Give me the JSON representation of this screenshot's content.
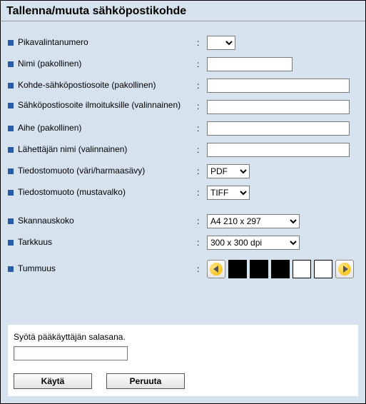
{
  "title": "Tallenna/muuta sähköpostikohde",
  "fields": {
    "speeddial": {
      "label": "Pikavalintanumero",
      "value": ""
    },
    "name": {
      "label": "Nimi (pakollinen)",
      "value": ""
    },
    "destemail": {
      "label": "Kohde-sähköpostiosoite (pakollinen)",
      "value": ""
    },
    "notifyemail": {
      "label": "Sähköpostiosoite ilmoituksille (valinnainen)",
      "value": ""
    },
    "subject": {
      "label": "Aihe (pakollinen)",
      "value": ""
    },
    "sender": {
      "label": "Lähettäjän nimi (valinnainen)",
      "value": ""
    },
    "formatcolor": {
      "label": "Tiedostomuoto (väri/harmaasävy)",
      "value": "PDF"
    },
    "formatbw": {
      "label": "Tiedostomuoto (mustavalko)",
      "value": "TIFF"
    },
    "scansize": {
      "label": "Skannauskoko",
      "value": "A4 210 x 297"
    },
    "resolution": {
      "label": "Tarkkuus",
      "value": "300 x 300 dpi"
    },
    "darkness": {
      "label": "Tummuus",
      "selected": 3,
      "levels": [
        true,
        true,
        true,
        false,
        false
      ]
    }
  },
  "admin": {
    "prompt": "Syötä pääkäyttäjän salasana.",
    "password": ""
  },
  "buttons": {
    "apply": "Käytä",
    "cancel": "Peruuta"
  }
}
